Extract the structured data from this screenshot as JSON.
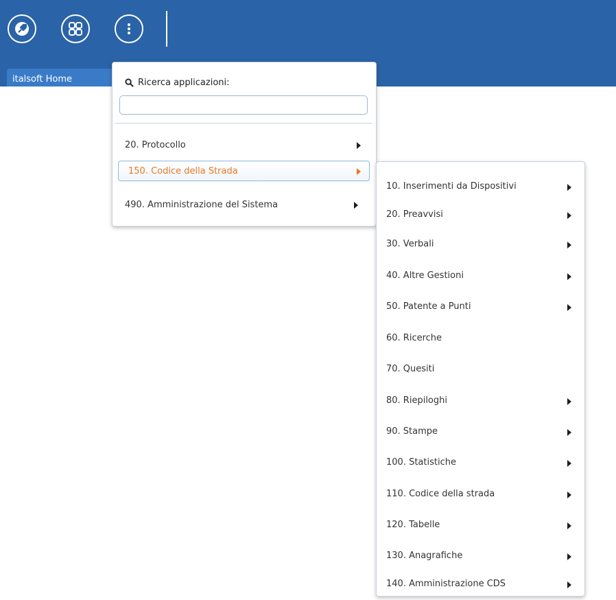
{
  "toolbar": {
    "icons": [
      "rocket-icon",
      "apps-grid-icon",
      "more-vertical-icon"
    ],
    "home_tab_label": "italsoft Home"
  },
  "app_menu": {
    "search_label": "Ricerca applicazioni:",
    "search_value": "",
    "search_placeholder": "",
    "items": [
      {
        "label": "20. Protocollo",
        "has_submenu": true
      },
      {
        "label": "150. Codice della Strada",
        "has_submenu": true,
        "active": true
      },
      {
        "label": "490. Amministrazione del Sistema",
        "has_submenu": true
      }
    ]
  },
  "submenu": {
    "items": [
      {
        "label": "10. Inserimenti da Dispositivi",
        "has_submenu": true
      },
      {
        "label": "20. Preavvisi",
        "has_submenu": true
      },
      {
        "label": "30. Verbali",
        "has_submenu": true
      },
      {
        "label": "40. Altre Gestioni",
        "has_submenu": true
      },
      {
        "label": "50. Patente a Punti",
        "has_submenu": true
      },
      {
        "label": "60. Ricerche",
        "has_submenu": false
      },
      {
        "label": "70. Quesiti",
        "has_submenu": false
      },
      {
        "label": "80. Riepiloghi",
        "has_submenu": true
      },
      {
        "label": "90. Stampe",
        "has_submenu": true
      },
      {
        "label": "100. Statistiche",
        "has_submenu": true
      },
      {
        "label": "110. Codice della strada",
        "has_submenu": true
      },
      {
        "label": "120. Tabelle",
        "has_submenu": true
      },
      {
        "label": "130. Anagrafiche",
        "has_submenu": true
      },
      {
        "label": "140. Amministrazione CDS",
        "has_submenu": true
      }
    ]
  },
  "colors": {
    "header_bg": "#2a63a7",
    "tab_bg": "#3a7bc8",
    "active_text": "#e87722"
  }
}
